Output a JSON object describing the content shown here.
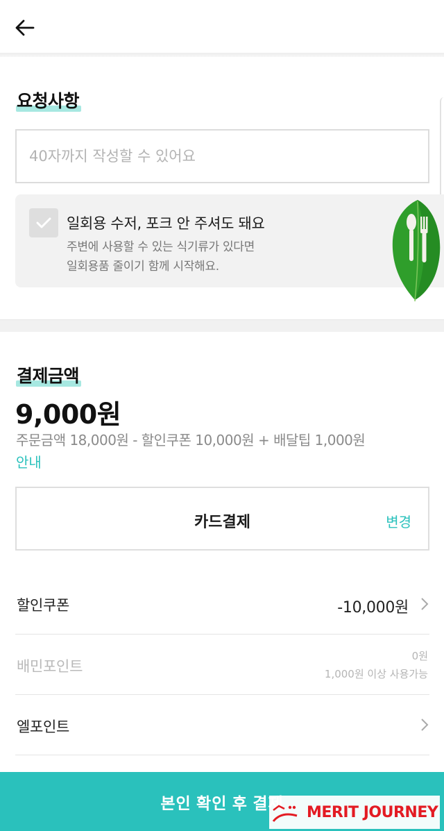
{
  "request": {
    "title": "요청사항",
    "placeholder": "40자까지 작성할 수 있어요",
    "eco_option": {
      "label": "일회용 수저, 포크 안 주셔도 돼요",
      "desc_line1": "주변에 사용할 수 있는 식기류가 있다면",
      "desc_line2": "일회용품 줄이기 함께 시작해요.",
      "checked": false
    }
  },
  "payment": {
    "title": "결제금액",
    "total": "9,000원",
    "breakdown": "주문금액 18,000원 - 할인쿠폰 10,000원 + 배달팁 1,000원",
    "guide_link": "안내",
    "method": {
      "label": "카드결제",
      "change": "변경"
    },
    "rows": [
      {
        "label": "할인쿠폰",
        "value": "-10,000원"
      },
      {
        "label": "배민포인트",
        "value": "0원",
        "note": "1,000원 이상 사용가능"
      },
      {
        "label": "엘포인트",
        "value": ""
      }
    ]
  },
  "pay_button": "본인 확인 후 결제",
  "watermark": "MERIT JOURNEY",
  "colors": {
    "accent": "#2ac1bc",
    "highlight": "#a7e8e1",
    "watermark": "#e31b23"
  }
}
